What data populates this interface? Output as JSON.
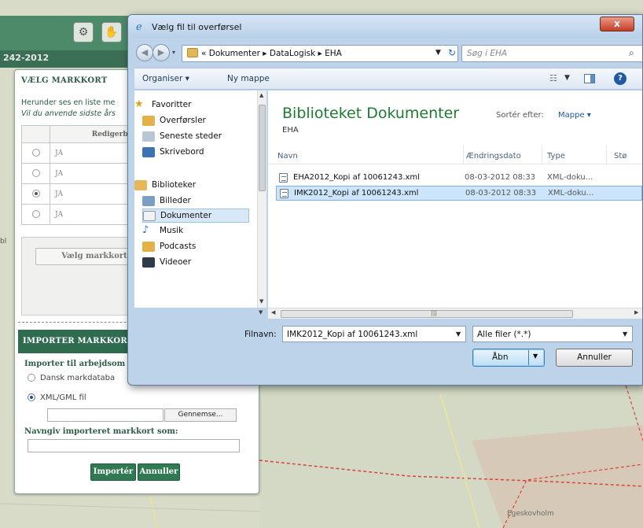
{
  "map": {
    "header_text": "242-2012",
    "side_label": "bl",
    "village": "Egeskovholm"
  },
  "panel": {
    "title": "VÆLG MARKKORT",
    "intro_line1": "Herunder ses en liste me",
    "intro_line2": "Vil du anvende sidste års",
    "table": {
      "header": "Redigerbar",
      "rows": [
        {
          "value": "JA",
          "selected": false
        },
        {
          "value": "JA",
          "selected": false
        },
        {
          "value": "JA",
          "selected": true
        },
        {
          "value": "JA",
          "selected": false
        }
      ]
    },
    "pick_button": "Vælg markkort",
    "import_header": "IMPORTER MARKKORT",
    "import_to_label": "Importer til arbejdsom",
    "option_danish": "Dansk markdataba",
    "option_xml": "XML/GML fil",
    "browse_button": "Gennemse...",
    "name_label": "Navngiv importeret markkort som:",
    "import_button": "Importér",
    "cancel_button": "Annuller"
  },
  "dialog": {
    "title": "Vælg fil til overførsel",
    "close_label": "x",
    "address": {
      "path": "« Dokumenter ▸ DataLogisk ▸ EHA"
    },
    "search_placeholder": "Søg i EHA",
    "toolbar": {
      "organise": "Organiser ▾",
      "new_folder": "Ny mappe",
      "help": "?"
    },
    "nav": {
      "favorites": "Favoritter",
      "favorites_items": [
        "Overførsler",
        "Seneste steder",
        "Skrivebord"
      ],
      "libraries": "Biblioteker",
      "library_items": [
        "Billeder",
        "Dokumenter",
        "Musik",
        "Podcasts",
        "Videoer"
      ],
      "selected": "Dokumenter"
    },
    "library": {
      "title": "Biblioteket Dokumenter",
      "subtitle": "EHA",
      "sort_label": "Sortér efter:",
      "sort_value": "Mappe ▾"
    },
    "columns": [
      "Navn",
      "Ændringsdato",
      "Type",
      "Stø"
    ],
    "files": [
      {
        "name": "EHA2012_Kopi af 10061243.xml",
        "date": "08-03-2012 08:33",
        "type": "XML-doku...",
        "selected": false
      },
      {
        "name": "IMK2012_Kopi af 10061243.xml",
        "date": "08-03-2012 08:33",
        "type": "XML-doku...",
        "selected": true
      }
    ],
    "filename_label": "Filnavn:",
    "filename_value": "IMK2012_Kopi af 10061243.xml",
    "filter_value": "Alle filer (*.*)",
    "open_button": "Åbn",
    "cancel_button": "Annuller"
  },
  "colors": {
    "panel_header": "#2f6b4e",
    "library_title": "#1f7a33",
    "selection": "#cde5fb",
    "close_button": "#c43e26"
  }
}
